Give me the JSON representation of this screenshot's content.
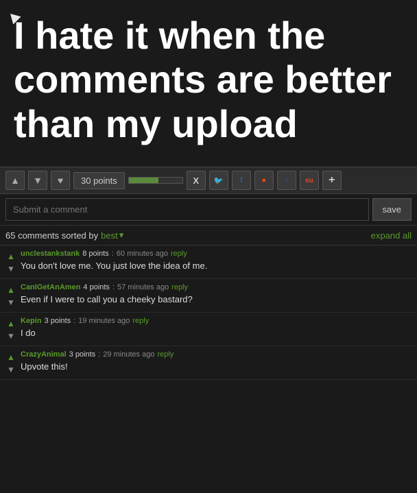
{
  "hero": {
    "text": "I hate it when the comments are better than my upload"
  },
  "toolbar": {
    "points": "30 points",
    "progress_pct": 55,
    "share_buttons": [
      "X",
      "🐦",
      "f",
      "●",
      "t",
      "su",
      "+"
    ]
  },
  "comment_input": {
    "placeholder": "Submit a comment",
    "save_label": "save"
  },
  "comments_header": {
    "count_label": "65 comments sorted by",
    "sort_label": "best",
    "expand_label": "expand all"
  },
  "comments": [
    {
      "author": "unclestankstank",
      "points": "8 points",
      "separator": ":",
      "time": "60 minutes ago",
      "reply_label": "reply",
      "text": "You don't love me. You just love the idea of me."
    },
    {
      "author": "CanIGetAnAmen",
      "points": "4 points",
      "separator": ":",
      "time": "57 minutes ago",
      "reply_label": "reply",
      "text": "Even if I were to call you a cheeky bastard?"
    },
    {
      "author": "Kepin",
      "points": "3 points",
      "separator": ":",
      "time": "19 minutes ago",
      "reply_label": "reply",
      "text": "I do"
    },
    {
      "author": "CrazyAnimal",
      "points": "3 points",
      "separator": ":",
      "time": "29 minutes ago",
      "reply_label": "reply",
      "text": "Upvote this!"
    }
  ]
}
